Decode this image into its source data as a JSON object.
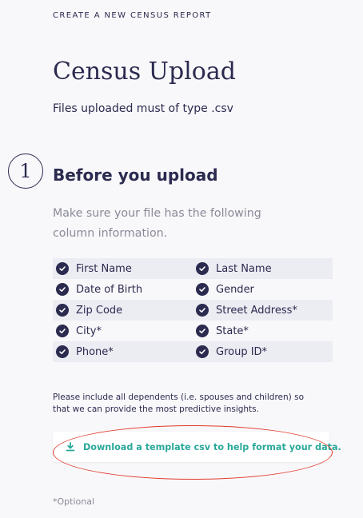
{
  "header": {
    "eyebrow": "CREATE A NEW CENSUS REPORT",
    "title": "Census Upload",
    "subtitle": "Files uploaded must of type .csv"
  },
  "step": {
    "number": "1",
    "title": "Before you upload",
    "description": "Make sure your file has the following column information."
  },
  "columns": [
    [
      "First Name",
      "Last Name"
    ],
    [
      "Date of Birth",
      "Gender"
    ],
    [
      "Zip Code",
      "Street Address*"
    ],
    [
      "City*",
      "State*"
    ],
    [
      "Phone*",
      "Group ID*"
    ]
  ],
  "note": "Please include all dependents (i.e. spouses and children) so that we can provide the most predictive insights.",
  "download": {
    "label": "Download a template csv to help format your data.",
    "icon": "download-icon"
  },
  "footer": {
    "optional_note": "*Optional"
  },
  "colors": {
    "primary": "#2b2a4f",
    "accent": "#2aa89a",
    "muted": "#8a8a99",
    "annotation": "#e0392b"
  }
}
